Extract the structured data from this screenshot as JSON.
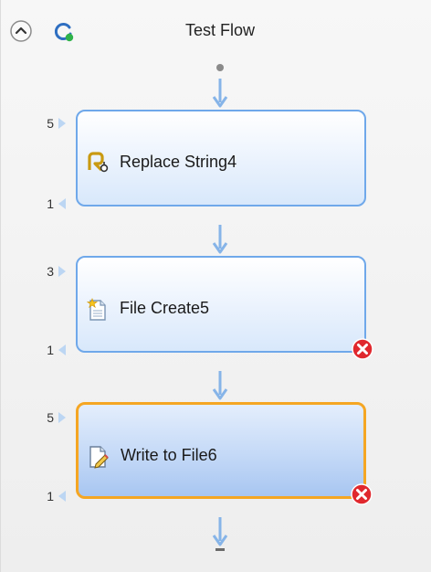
{
  "header": {
    "title": "Test Flow",
    "collapse_icon": "chevron-up-circle-icon",
    "refresh_icon": "refresh-status-icon"
  },
  "steps": [
    {
      "label": "Replace String4",
      "icon": "replace-string-icon",
      "input_count": "5",
      "output_count": "1",
      "has_error": false,
      "selected": false
    },
    {
      "label": "File Create5",
      "icon": "file-create-icon",
      "input_count": "3",
      "output_count": "1",
      "has_error": true,
      "selected": false
    },
    {
      "label": "Write to File6",
      "icon": "write-file-icon",
      "input_count": "5",
      "output_count": "1",
      "has_error": true,
      "selected": true
    }
  ],
  "colors": {
    "step_border": "#6fa8ea",
    "selected_border": "#f5a623",
    "connector_arrow": "#86b4e8",
    "error_badge": "#e0282e"
  }
}
